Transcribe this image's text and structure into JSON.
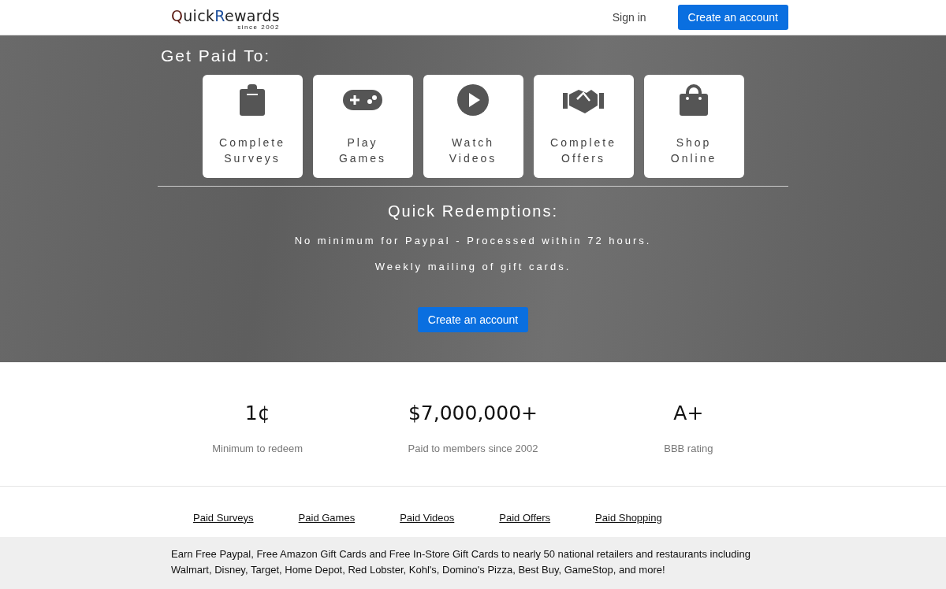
{
  "header": {
    "logo": {
      "parts": [
        {
          "text": "Q",
          "color": "#5a1a12"
        },
        {
          "text": "uick",
          "color": "#222222"
        },
        {
          "text": "R",
          "color": "#1d4f9c"
        },
        {
          "text": "ewards",
          "color": "#222222"
        }
      ],
      "tagline": "since 2002"
    },
    "sign_in": "Sign in",
    "create_account": "Create an account"
  },
  "hero": {
    "heading": "Get Paid To:",
    "cards": [
      {
        "kind": "clipboard",
        "line1": "Complete",
        "line2": "Surveys"
      },
      {
        "kind": "gamepad",
        "line1": "Play",
        "line2": "Games"
      },
      {
        "kind": "play",
        "line1": "Watch",
        "line2": "Videos"
      },
      {
        "kind": "handshake",
        "line1": "Complete",
        "line2": "Offers"
      },
      {
        "kind": "bag",
        "line1": "Shop",
        "line2": "Online"
      }
    ],
    "redemptions_heading": "Quick Redemptions:",
    "lines": [
      "No minimum for Paypal - Processed within 72 hours.",
      "Weekly mailing of gift cards."
    ],
    "button": "Create an account"
  },
  "stats": [
    {
      "value": "1¢",
      "label": "Minimum to redeem"
    },
    {
      "value": "$7,000,000+",
      "label": "Paid to members since 2002"
    },
    {
      "value": "A+",
      "label": "BBB rating"
    }
  ],
  "links": [
    "Paid Surveys",
    "Paid Games",
    "Paid Videos",
    "Paid Offers",
    "Paid Shopping"
  ],
  "footer_text": "Earn Free Paypal, Free Amazon Gift Cards and Free In-Store Gift Cards to nearly 50 national retailers and restaurants including Walmart, Disney, Target, Home Depot, Red Lobster, Kohl's, Domino's Pizza, Best Buy, GameStop, and more!"
}
